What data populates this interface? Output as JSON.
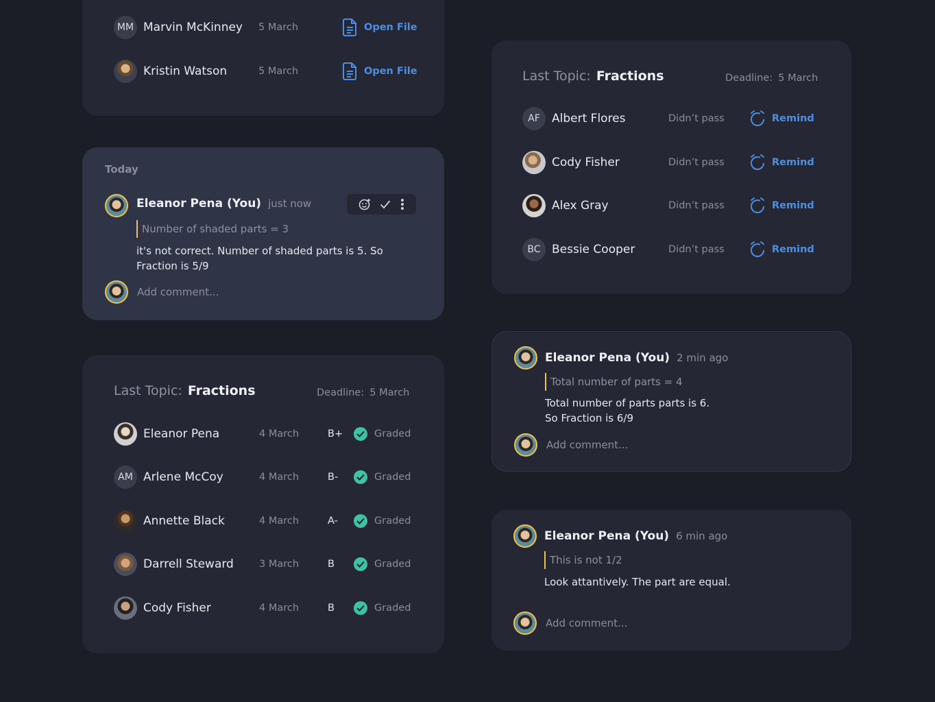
{
  "files_card": {
    "rows": [
      {
        "initials": "MM",
        "name": "Marvin McKinney",
        "date": "5 March",
        "action": "Open File"
      },
      {
        "initials": "",
        "name": "Kristin Watson",
        "date": "5 March",
        "action": "Open File"
      }
    ]
  },
  "today_card": {
    "heading": "Today",
    "author": "Eleanor Pena (You)",
    "time": "just now",
    "quote": "Number of shaded parts = 3",
    "body_line1": "it's not correct. Number of shaded parts is 5. So",
    "body_line2": "Fraction is 5/9",
    "add_comment": "Add comment..."
  },
  "graded_card": {
    "topic_label": "Last Topic:",
    "topic_value": "Fractions",
    "deadline_label": "Deadline:",
    "deadline_value": "5 March",
    "rows": [
      {
        "initials": "",
        "name": "Eleanor Pena",
        "date": "4 March",
        "grade": "B+",
        "status": "Graded"
      },
      {
        "initials": "AM",
        "name": "Arlene McCoy",
        "date": "4 March",
        "grade": "B-",
        "status": "Graded"
      },
      {
        "initials": "",
        "name": "Annette Black",
        "date": "4 March",
        "grade": "A-",
        "status": "Graded"
      },
      {
        "initials": "",
        "name": "Darrell Steward",
        "date": "3 March",
        "grade": "B",
        "status": "Graded"
      },
      {
        "initials": "",
        "name": "Cody Fisher",
        "date": "4 March",
        "grade": "B",
        "status": "Graded"
      }
    ]
  },
  "remind_card": {
    "topic_label": "Last Topic:",
    "topic_value": "Fractions",
    "deadline_label": "Deadline:",
    "deadline_value": "5 March",
    "rows": [
      {
        "initials": "AF",
        "name": "Albert Flores",
        "status": "Didn’t pass",
        "action": "Remind"
      },
      {
        "initials": "",
        "name": "Cody Fisher",
        "status": "Didn’t pass",
        "action": "Remind"
      },
      {
        "initials": "",
        "name": "Alex Gray",
        "status": "Didn’t pass",
        "action": "Remind"
      },
      {
        "initials": "BC",
        "name": "Bessie Cooper",
        "status": "Didn’t pass",
        "action": "Remind"
      }
    ]
  },
  "comment_card_1": {
    "author": "Eleanor Pena (You)",
    "time": "2 min ago",
    "quote": "Total number of parts = 4",
    "body_line1": "Total number of parts parts is 6.",
    "body_line2": "So Fraction is 6/9",
    "add_comment": "Add comment..."
  },
  "comment_card_2": {
    "author": "Eleanor Pena (You)",
    "time": "6 min ago",
    "quote": "This is not 1/2",
    "body_line1": "Look attantively. The part are equal.",
    "add_comment": "Add comment..."
  },
  "colors": {
    "background": "#1b1d27",
    "card": "#252834",
    "accent_link": "#4d8ee0",
    "graded_green": "#3fc2a4",
    "quote_bar": "#f0c14b"
  }
}
